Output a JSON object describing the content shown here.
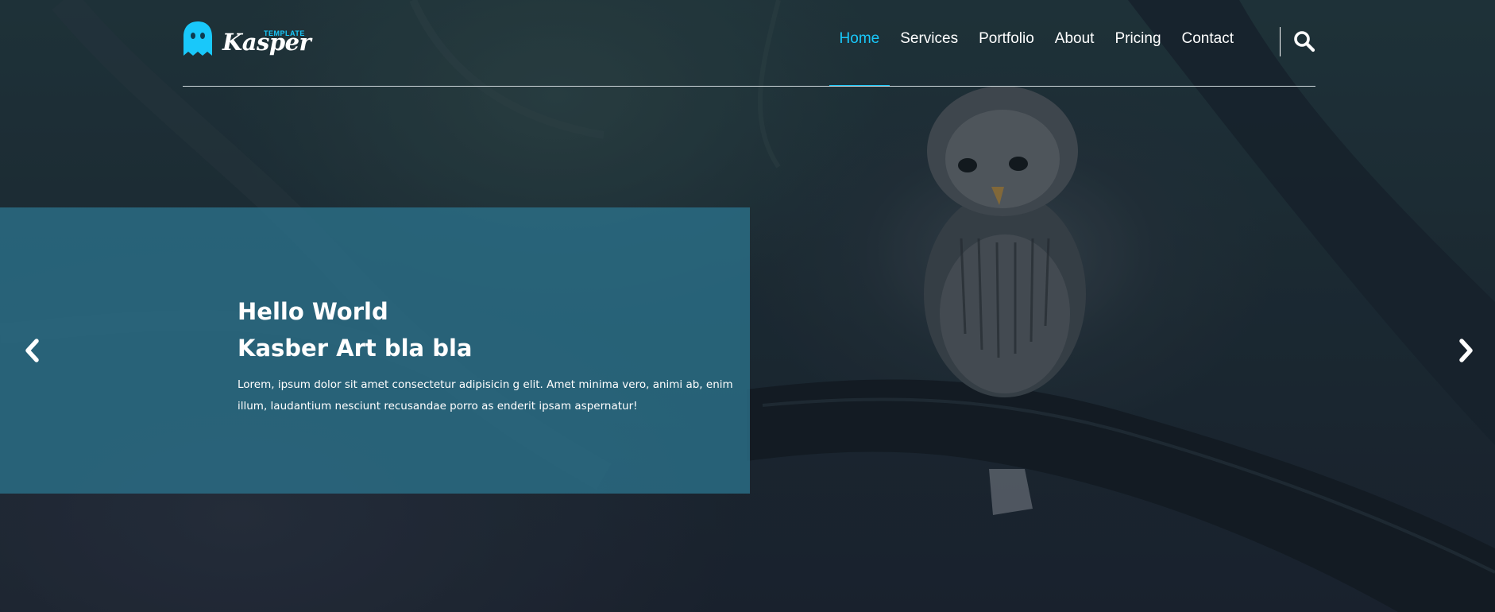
{
  "logo": {
    "tagline": "TEMPLATE",
    "wordmark": "Kasper",
    "accent_color": "#19c8fa"
  },
  "nav": {
    "items": [
      {
        "label": "Home",
        "active": true
      },
      {
        "label": "Services",
        "active": false
      },
      {
        "label": "Portfolio",
        "active": false
      },
      {
        "label": "About",
        "active": false
      },
      {
        "label": "Pricing",
        "active": false
      },
      {
        "label": "Contact",
        "active": false
      }
    ],
    "search_icon": "search-icon"
  },
  "slide": {
    "title_line1": "Hello World",
    "title_line2": "Kasber Art bla bla",
    "text": "Lorem, ipsum dolor sit amet consectetur adipisicin g elit. Amet minima vero, animi ab, enim illum, laudantium nesciunt recusandae porro as enderit ipsam aspernatur!",
    "prev_icon": "chevron-left-icon",
    "next_icon": "chevron-right-icon",
    "box_color": "#2b6f87"
  }
}
